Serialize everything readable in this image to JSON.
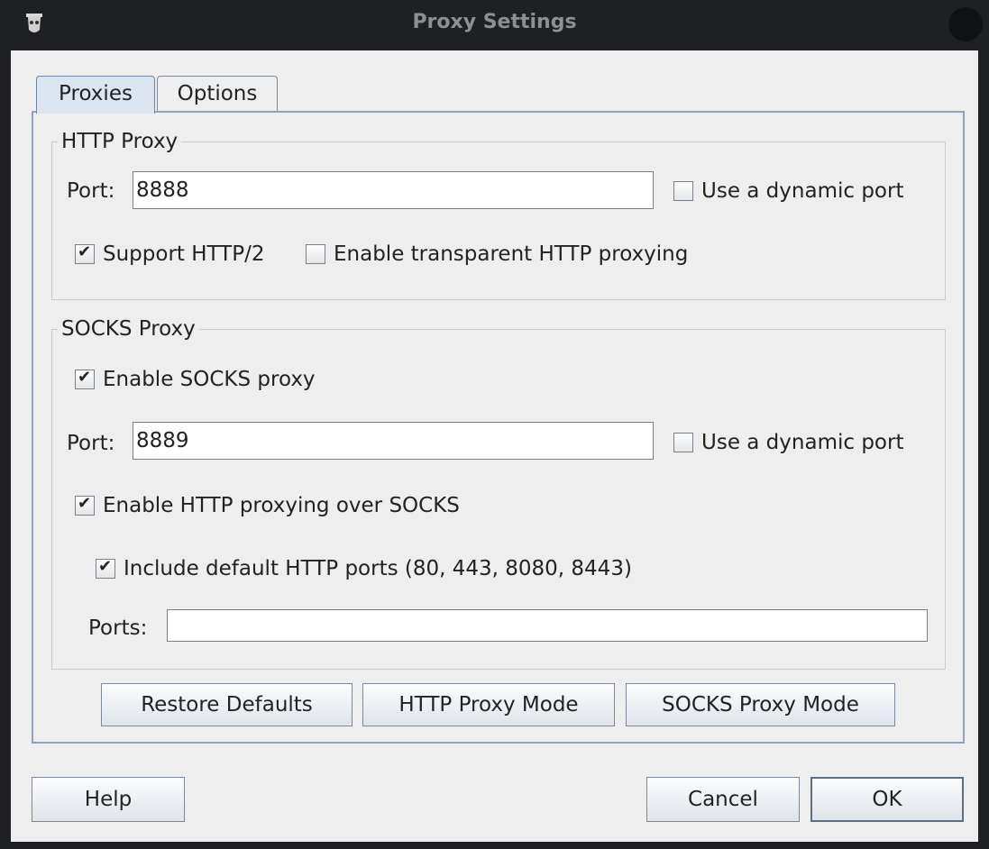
{
  "window": {
    "title": "Proxy Settings",
    "icon": "app-icon"
  },
  "tabs": [
    {
      "label": "Proxies",
      "active": true
    },
    {
      "label": "Options",
      "active": false
    }
  ],
  "http_proxy": {
    "legend": "HTTP Proxy",
    "port_label": "Port:",
    "port_value": "8888",
    "dynamic_port": {
      "label": "Use a dynamic port",
      "checked": false
    },
    "support_http2": {
      "label": "Support HTTP/2",
      "checked": true
    },
    "transparent": {
      "label": "Enable transparent HTTP proxying",
      "checked": false
    }
  },
  "socks_proxy": {
    "legend": "SOCKS Proxy",
    "enable": {
      "label": "Enable SOCKS proxy",
      "checked": true
    },
    "port_label": "Port:",
    "port_value": "8889",
    "dynamic_port": {
      "label": "Use a dynamic port",
      "checked": false
    },
    "http_over_socks": {
      "label": "Enable HTTP proxying over SOCKS",
      "checked": true
    },
    "default_ports": {
      "label": "Include default HTTP ports (80, 443, 8080, 8443)",
      "checked": true
    },
    "ports_label": "Ports:",
    "ports_value": ""
  },
  "panel_buttons": {
    "restore": "Restore Defaults",
    "http_mode": "HTTP Proxy Mode",
    "socks_mode": "SOCKS Proxy Mode"
  },
  "dialog_buttons": {
    "help": "Help",
    "cancel": "Cancel",
    "ok": "OK"
  }
}
